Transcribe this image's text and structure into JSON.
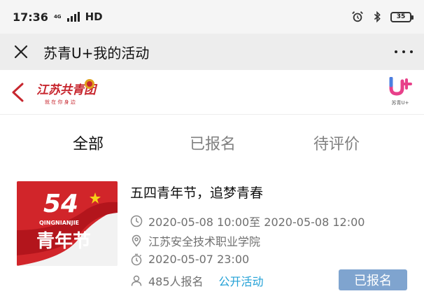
{
  "status_bar": {
    "time": "17:36",
    "network": "4G",
    "hd": "HD",
    "battery": "35"
  },
  "title_bar": {
    "title": "苏青U+我的活动"
  },
  "header": {
    "logo_left_text": "江苏共青团",
    "logo_left_slogan": "就在你身边",
    "logo_right_text": "苏青U+"
  },
  "tabs": [
    {
      "label": "全部",
      "active": true
    },
    {
      "label": "已报名",
      "active": false
    },
    {
      "label": "待评价",
      "active": false
    }
  ],
  "activity": {
    "image_big_text": "54",
    "image_pinyin": "QINGNIANJIE",
    "image_caption": "青年节",
    "title": "五四青年节，追梦青春",
    "time_range": "2020-05-08 10:00至 2020-05-08 12:00",
    "location": "江苏安全技术职业学院",
    "deadline": "2020-05-07 23:00",
    "signup_count": "485人报名",
    "tag": "公开活动",
    "status_button": "已报名"
  },
  "colors": {
    "accent_red": "#c41b22",
    "tag_blue": "#23a1d6",
    "status_button_bg": "#7fa4cf"
  }
}
